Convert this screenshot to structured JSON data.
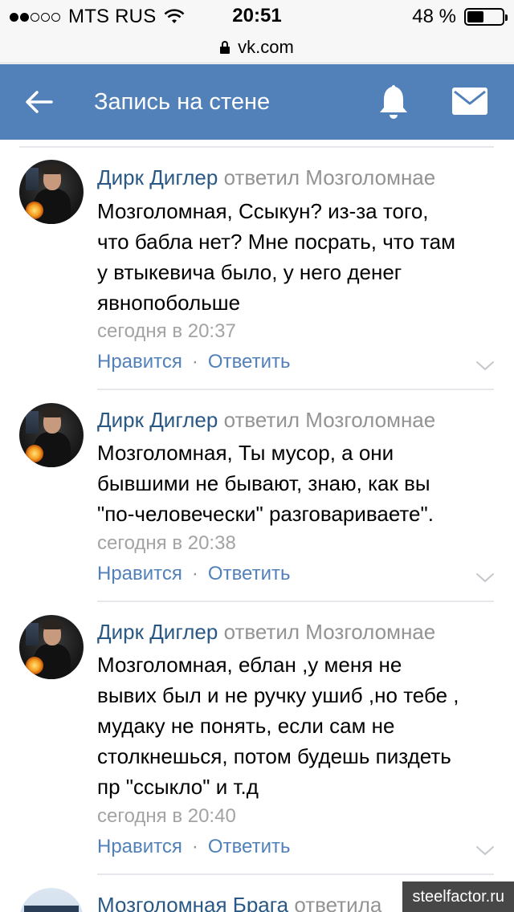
{
  "status_bar": {
    "carrier": "MTS RUS",
    "signal_filled": 2,
    "signal_total": 5,
    "time": "20:51",
    "battery_percent": "48 %",
    "battery_level": 0.48
  },
  "url_bar": {
    "domain": "vk.com"
  },
  "header": {
    "title": "Запись на стене",
    "background_color": "#5181b8",
    "icons": [
      "back-arrow-icon",
      "bell-icon",
      "mail-icon"
    ]
  },
  "comments": [
    {
      "author": "Дирк Диглер",
      "replied": "ответил Мозголомнае",
      "lines": [
        "Мозголомная, Ссыкун? из-за того,",
        "что бабла нет? Мне посрать, что там",
        "у втыкевича было, у него денег",
        "явнопобольше"
      ],
      "time": "сегодня в 20:37",
      "like": "Нравится",
      "dot": "·",
      "reply": "Ответить"
    },
    {
      "author": "Дирк Диглер",
      "replied": "ответил Мозголомнае",
      "lines": [
        "Мозголомная, Ты мусор, а они",
        "бывшими не бывают, знаю, как вы",
        "\"по-человечески\" разговариваете\"."
      ],
      "time": "сегодня в 20:38",
      "like": "Нравится",
      "dot": "·",
      "reply": "Ответить"
    },
    {
      "author": "Дирк Диглер",
      "replied": "ответил Мозголомнае",
      "lines": [
        "Мозголомная, еблан ,у меня не",
        "вывих был и не ручку ушиб ,но тебе ,",
        "мудаку не понять, если сам не",
        "столкнешься, потом будешь пиздеть",
        "пр \"ссыкло\" и т.д"
      ],
      "time": "сегодня в 20:40",
      "like": "Нравится",
      "dot": "·",
      "reply": "Ответить"
    },
    {
      "author": "Мозголомная Брага",
      "replied": "ответила"
    }
  ],
  "watermark": "steelfactor.ru"
}
